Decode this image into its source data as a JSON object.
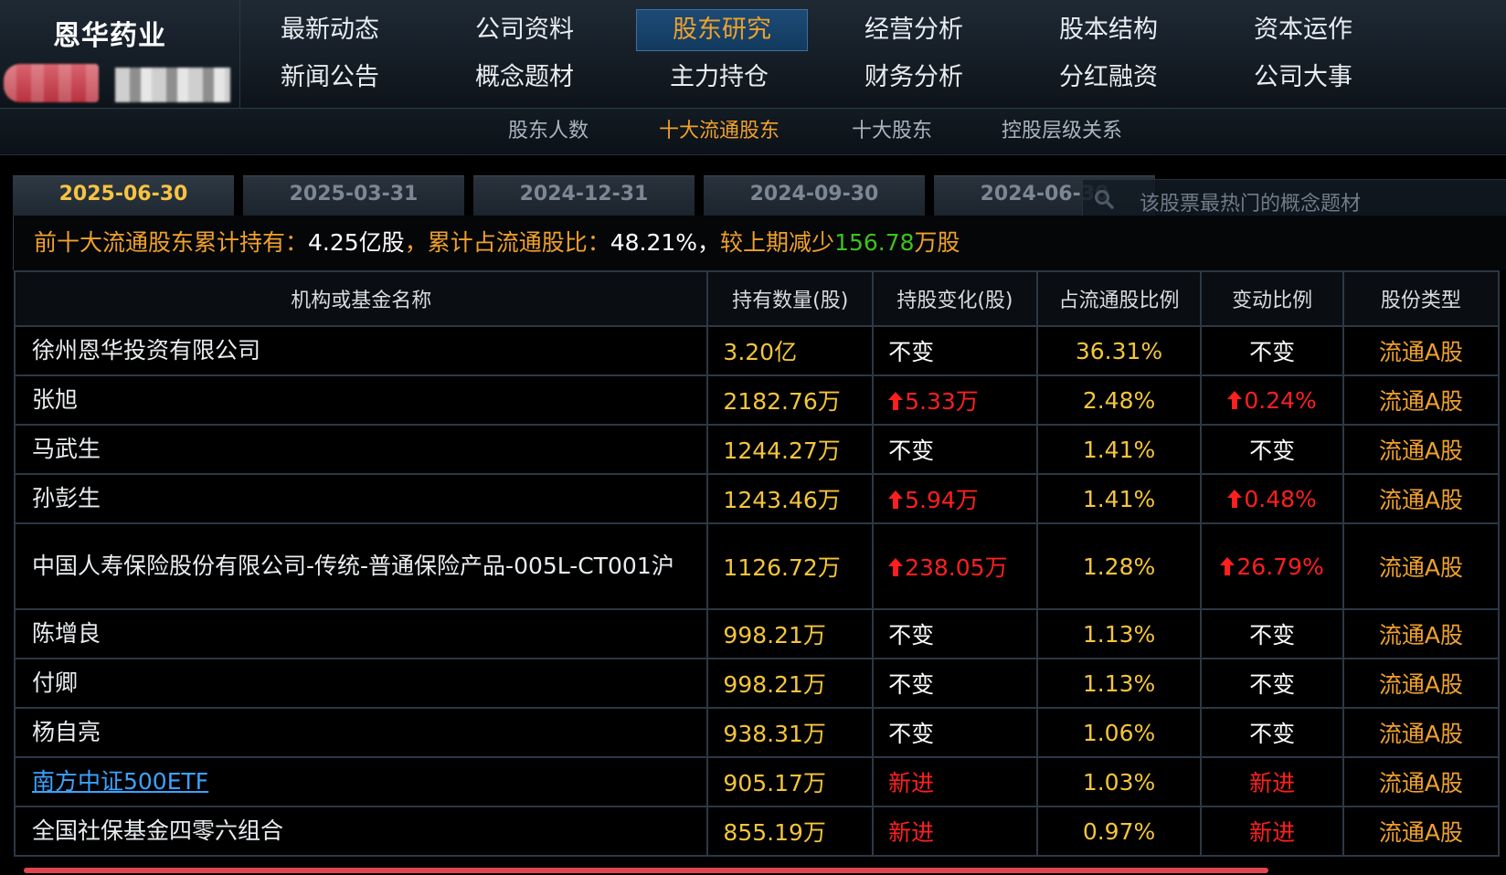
{
  "brand": {
    "name": "恩华药业"
  },
  "nav": {
    "row1": [
      "最新动态",
      "公司资料",
      "股东研究",
      "经营分析",
      "股本结构",
      "资本运作"
    ],
    "row2": [
      "新闻公告",
      "概念题材",
      "主力持仓",
      "财务分析",
      "分红融资",
      "公司大事"
    ],
    "active": "股东研究"
  },
  "subnav": {
    "items": [
      "股东人数",
      "十大流通股东",
      "十大股东",
      "控股层级关系"
    ],
    "active": "十大流通股东"
  },
  "date_tabs": {
    "items": [
      "2025-06-30",
      "2025-03-31",
      "2024-12-31",
      "2024-09-30",
      "2024-06-30"
    ],
    "active": "2025-06-30"
  },
  "search": {
    "placeholder": "该股票最热门的概念题材"
  },
  "summary": {
    "label1": "前十大流通股东累计持有：",
    "value1": "4.25亿股",
    "label2": "，累计占流通股比：",
    "value2": "48.21%",
    "sep": "，",
    "label3": "较上期减少",
    "value3": "156.78",
    "unit3": "万股"
  },
  "table": {
    "headers": [
      "机构或基金名称",
      "持有数量(股)",
      "持股变化(股)",
      "占流通股比例",
      "变动比例",
      "股份类型"
    ],
    "rows": [
      {
        "name": "徐州恩华投资有限公司",
        "amount": "3.20亿",
        "change": "不变",
        "change_up": false,
        "change_color": "white",
        "ratio": "36.31%",
        "cratio": "不变",
        "cratio_up": false,
        "cratio_color": "white",
        "stype": "流通A股"
      },
      {
        "name": "张旭",
        "amount": "2182.76万",
        "change": "5.33万",
        "change_up": true,
        "change_color": "red",
        "ratio": "2.48%",
        "cratio": "0.24%",
        "cratio_up": true,
        "cratio_color": "red",
        "stype": "流通A股"
      },
      {
        "name": "马武生",
        "amount": "1244.27万",
        "change": "不变",
        "change_up": false,
        "change_color": "white",
        "ratio": "1.41%",
        "cratio": "不变",
        "cratio_up": false,
        "cratio_color": "white",
        "stype": "流通A股"
      },
      {
        "name": "孙彭生",
        "amount": "1243.46万",
        "change": "5.94万",
        "change_up": true,
        "change_color": "red",
        "ratio": "1.41%",
        "cratio": "0.48%",
        "cratio_up": true,
        "cratio_color": "red",
        "stype": "流通A股"
      },
      {
        "name": "中国人寿保险股份有限公司-传统-普通保险产品-005L-CT001沪",
        "amount": "1126.72万",
        "change": "238.05万",
        "change_up": true,
        "change_color": "red",
        "ratio": "1.28%",
        "cratio": "26.79%",
        "cratio_up": true,
        "cratio_color": "red",
        "stype": "流通A股"
      },
      {
        "name": "陈增良",
        "amount": "998.21万",
        "change": "不变",
        "change_up": false,
        "change_color": "white",
        "ratio": "1.13%",
        "cratio": "不变",
        "cratio_up": false,
        "cratio_color": "white",
        "stype": "流通A股"
      },
      {
        "name": "付卿",
        "amount": "998.21万",
        "change": "不变",
        "change_up": false,
        "change_color": "white",
        "ratio": "1.13%",
        "cratio": "不变",
        "cratio_up": false,
        "cratio_color": "white",
        "stype": "流通A股"
      },
      {
        "name": "杨自亮",
        "amount": "938.31万",
        "change": "不变",
        "change_up": false,
        "change_color": "white",
        "ratio": "1.06%",
        "cratio": "不变",
        "cratio_up": false,
        "cratio_color": "white",
        "stype": "流通A股"
      },
      {
        "name": "南方中证500ETF",
        "link": true,
        "amount": "905.17万",
        "change": "新进",
        "change_up": false,
        "change_color": "red",
        "ratio": "1.03%",
        "cratio": "新进",
        "cratio_up": false,
        "cratio_color": "red",
        "stype": "流通A股"
      },
      {
        "name": "全国社保基金四零六组合",
        "amount": "855.19万",
        "change": "新进",
        "change_up": false,
        "change_color": "red",
        "ratio": "0.97%",
        "cratio": "新进",
        "cratio_up": false,
        "cratio_color": "red",
        "stype": "流通A股"
      }
    ]
  },
  "colors": {
    "accent_orange": "#f0a12c",
    "value_yellow": "#f5c53b",
    "up_red": "#ff1f1f",
    "decrease_green": "#3dc21b",
    "link_blue": "#3aa3ff"
  }
}
